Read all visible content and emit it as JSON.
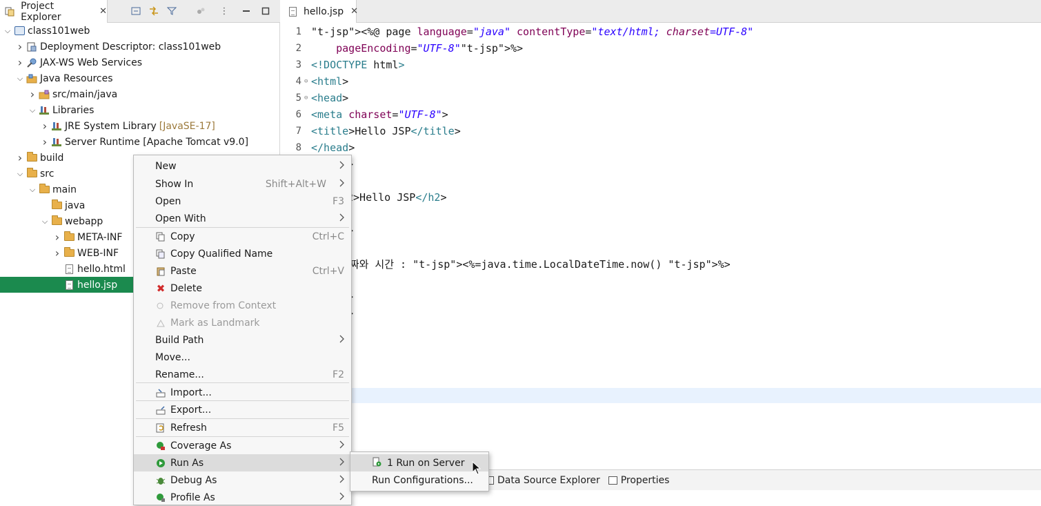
{
  "explorer": {
    "tab_label": "Project Explorer",
    "tab_icon": "project-explorer-icon",
    "tree": [
      {
        "label": "class101web",
        "extra": "",
        "icon": "project-icon",
        "expanded": true,
        "depth": 0
      },
      {
        "label": "Deployment Descriptor: class101web",
        "extra": "",
        "icon": "deployment-descriptor-icon",
        "expanded": false,
        "depth": 1
      },
      {
        "label": "JAX-WS Web Services",
        "extra": "",
        "icon": "web-services-icon",
        "expanded": false,
        "depth": 1
      },
      {
        "label": "Java Resources",
        "extra": "",
        "icon": "java-resources-icon",
        "expanded": true,
        "depth": 1
      },
      {
        "label": "src/main/java",
        "extra": "",
        "icon": "source-folder-icon",
        "expanded": false,
        "depth": 2
      },
      {
        "label": "Libraries",
        "extra": "",
        "icon": "library-icon",
        "expanded": true,
        "depth": 2
      },
      {
        "label": "JRE System Library",
        "extra": "[JavaSE-17]",
        "icon": "library-icon",
        "expanded": false,
        "depth": 3
      },
      {
        "label": "Server Runtime [Apache Tomcat v9.0]",
        "extra": "",
        "icon": "library-icon",
        "expanded": false,
        "depth": 3
      },
      {
        "label": "build",
        "extra": "",
        "icon": "folder-icon",
        "expanded": false,
        "depth": 1
      },
      {
        "label": "src",
        "extra": "",
        "icon": "folder-icon",
        "expanded": true,
        "depth": 1
      },
      {
        "label": "main",
        "extra": "",
        "icon": "folder-icon",
        "expanded": true,
        "depth": 2
      },
      {
        "label": "java",
        "extra": "",
        "icon": "folder-icon",
        "expanded": null,
        "depth": 3
      },
      {
        "label": "webapp",
        "extra": "",
        "icon": "folder-icon",
        "expanded": true,
        "depth": 3
      },
      {
        "label": "META-INF",
        "extra": "",
        "icon": "folder-icon",
        "expanded": false,
        "depth": 4
      },
      {
        "label": "WEB-INF",
        "extra": "",
        "icon": "folder-icon",
        "expanded": false,
        "depth": 4
      },
      {
        "label": "hello.html",
        "extra": "",
        "icon": "file-icon",
        "expanded": null,
        "depth": 4
      },
      {
        "label": "hello.jsp",
        "extra": "",
        "icon": "file-icon",
        "expanded": null,
        "depth": 4,
        "selected": true
      }
    ]
  },
  "editor": {
    "tab_label": "hello.jsp",
    "lines": [
      {
        "n": "1",
        "fold": "",
        "code": "<%@ page language=\"java\" contentType=\"text/html; charset=UTF-8\""
      },
      {
        "n": "2",
        "fold": "",
        "code": "    pageEncoding=\"UTF-8\"%>"
      },
      {
        "n": "3",
        "fold": "",
        "code": "<!DOCTYPE html>"
      },
      {
        "n": "4",
        "fold": "⊖",
        "code": "<html>"
      },
      {
        "n": "5",
        "fold": "⊖",
        "code": "<head>"
      },
      {
        "n": "6",
        "fold": "",
        "code": "<meta charset=\"UTF-8\">"
      },
      {
        "n": "7",
        "fold": "",
        "code": "<title>Hello JSP</title>"
      },
      {
        "n": "8",
        "fold": "",
        "code": "</head>"
      }
    ],
    "partial_lines": [
      {
        "code": ">"
      },
      {
        "code": "2>Hello JSP</h2>"
      },
      {
        "code": ">"
      },
      {
        "code": "날짜와 시간 : <%=java.time.LocalDateTime.now() %>"
      },
      {
        "code": ">"
      },
      {
        "code": ">"
      }
    ]
  },
  "bottom_panel": {
    "tabs": [
      {
        "label": "Data Source Explorer",
        "icon": "data-source-icon"
      },
      {
        "label": "Properties",
        "icon": "properties-icon"
      }
    ]
  },
  "context_menu": {
    "items": [
      {
        "label": "New",
        "accel": "",
        "submenu": true,
        "icon": "",
        "disabled": false
      },
      {
        "label": "Show In",
        "accel": "Shift+Alt+W",
        "submenu": true,
        "icon": "",
        "disabled": false
      },
      {
        "label": "Open",
        "accel": "F3",
        "submenu": false,
        "icon": "",
        "disabled": false
      },
      {
        "label": "Open With",
        "accel": "",
        "submenu": true,
        "icon": "",
        "disabled": false
      },
      {
        "label": "Copy",
        "accel": "Ctrl+C",
        "submenu": false,
        "icon": "copy-icon",
        "disabled": false
      },
      {
        "label": "Copy Qualified Name",
        "accel": "",
        "submenu": false,
        "icon": "copy-qualified-icon",
        "disabled": false
      },
      {
        "label": "Paste",
        "accel": "Ctrl+V",
        "submenu": false,
        "icon": "paste-icon",
        "disabled": false
      },
      {
        "label": "Delete",
        "accel": "",
        "submenu": false,
        "icon": "delete-icon",
        "disabled": false
      },
      {
        "label": "Remove from Context",
        "accel": "",
        "submenu": false,
        "icon": "remove-context-icon",
        "disabled": true
      },
      {
        "label": "Mark as Landmark",
        "accel": "",
        "submenu": false,
        "icon": "landmark-icon",
        "disabled": true
      },
      {
        "label": "Build Path",
        "accel": "",
        "submenu": true,
        "icon": "",
        "disabled": false
      },
      {
        "label": "Move...",
        "accel": "",
        "submenu": false,
        "icon": "",
        "disabled": false
      },
      {
        "label": "Rename...",
        "accel": "F2",
        "submenu": false,
        "icon": "",
        "disabled": false
      },
      {
        "label": "Import...",
        "accel": "",
        "submenu": false,
        "icon": "import-icon",
        "disabled": false
      },
      {
        "label": "Export...",
        "accel": "",
        "submenu": false,
        "icon": "export-icon",
        "disabled": false
      },
      {
        "label": "Refresh",
        "accel": "F5",
        "submenu": false,
        "icon": "refresh-icon",
        "disabled": false
      },
      {
        "label": "Coverage As",
        "accel": "",
        "submenu": true,
        "icon": "coverage-icon",
        "disabled": false
      },
      {
        "label": "Run As",
        "accel": "",
        "submenu": true,
        "icon": "run-icon",
        "disabled": false,
        "active": true
      },
      {
        "label": "Debug As",
        "accel": "",
        "submenu": true,
        "icon": "debug-icon",
        "disabled": false
      },
      {
        "label": "Profile As",
        "accel": "",
        "submenu": true,
        "icon": "profile-icon",
        "disabled": false
      }
    ]
  },
  "run_as_submenu": {
    "items": [
      {
        "label": "1 Run on Server",
        "icon": "run-on-server-icon",
        "active": true
      },
      {
        "label": "Run Configurations...",
        "icon": "",
        "active": false
      }
    ]
  },
  "colors": {
    "selection": "#1b8a4e",
    "menu_highlight": "#dcdcdc",
    "tag": "#2a7d8c",
    "attr": "#7f0055",
    "string": "#2a00ff",
    "jsp_delim": "#bf5f3f",
    "current_line": "#e8f2fe"
  }
}
